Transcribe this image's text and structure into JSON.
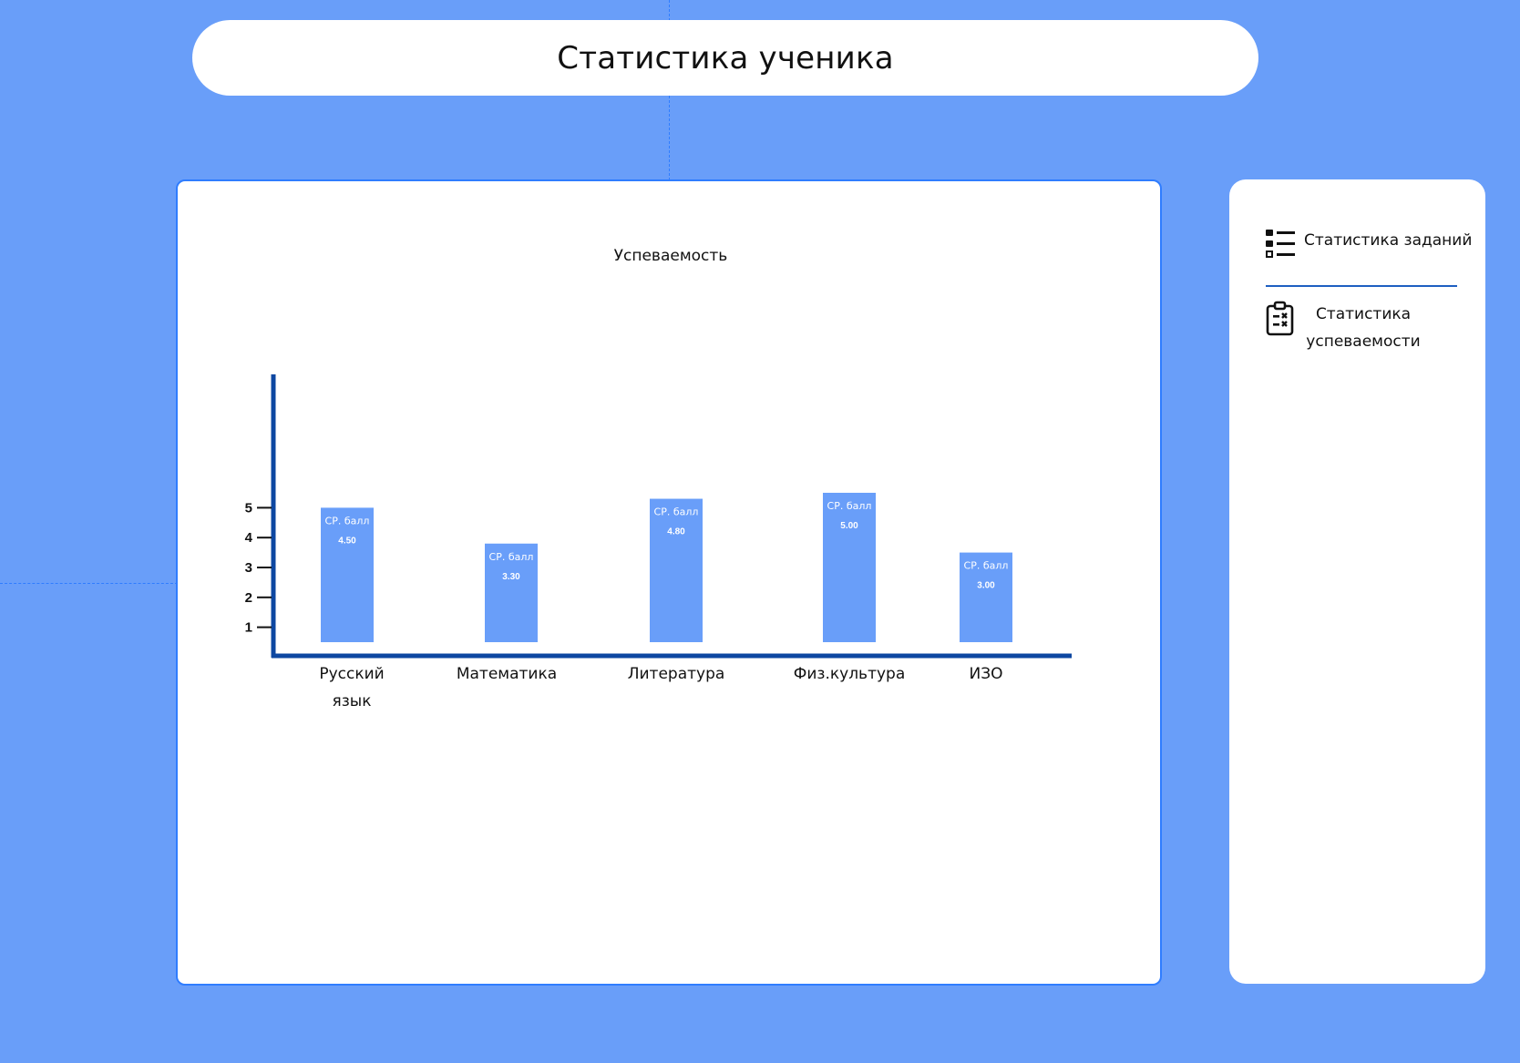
{
  "page": {
    "title": "Статистика ученика"
  },
  "panel": {
    "chart_title": "Успеваемость"
  },
  "sidebar": {
    "items": [
      {
        "label": "Статистика заданий",
        "icon": "list-icon"
      },
      {
        "label_lines": [
          "Статистика",
          "успеваемости"
        ],
        "icon": "clipboard-checklist-icon"
      }
    ]
  },
  "colors": {
    "background": "#699ef9",
    "bar": "#699ef9",
    "axis": "#0d47a1",
    "panel_border": "#2f7dff"
  },
  "chart_data": {
    "type": "bar",
    "title": "Успеваемость",
    "categories": [
      [
        "Русский",
        "язык"
      ],
      [
        "Математика"
      ],
      [
        "Литература"
      ],
      [
        "Физ.культура"
      ],
      [
        "ИЗО"
      ]
    ],
    "values": [
      4.5,
      3.3,
      4.8,
      5.0,
      3.0
    ],
    "bar_label_prefix": "СР. балл",
    "bar_value_labels": [
      "4.50",
      "3.30",
      "4.80",
      "5.00",
      "3.00"
    ],
    "y_ticks": [
      "1",
      "2",
      "3",
      "4",
      "5"
    ],
    "xlabel": "",
    "ylabel": "",
    "grid": false
  }
}
